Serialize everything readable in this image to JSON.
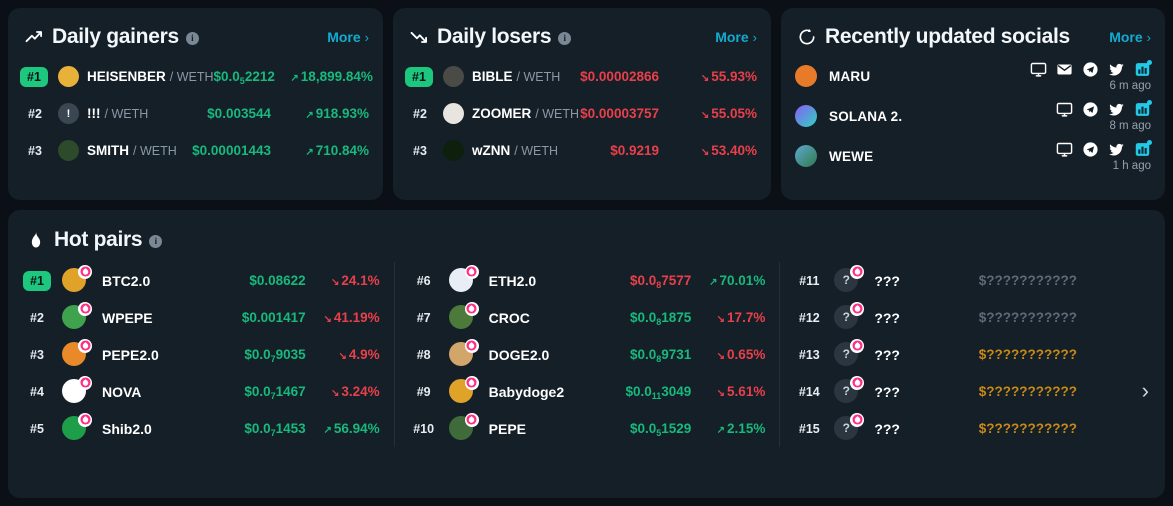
{
  "theme": {
    "page_bg": "#0a1016",
    "card_bg": "#151f28",
    "green": "#17b97c",
    "badge_green": "#1ec77e",
    "red": "#e8404a",
    "cyan": "#13abd0",
    "amber": "#c98a14",
    "muted": "#5d6b78"
  },
  "gainers": {
    "title": "Daily gainers",
    "icon": "trending-up-icon",
    "info": "i",
    "more_label": "More",
    "more_chevron": "›",
    "rows": [
      {
        "rank": "#1",
        "name": "HEISENBER",
        "quote": "/ WETH",
        "price_pre": "$0.0",
        "price_sub": "5",
        "price_post": "2212",
        "pct": "18,899.84%",
        "dir": "up",
        "arrow": "↗"
      },
      {
        "rank": "#2",
        "name": "!!!",
        "quote": "/ WETH",
        "price_pre": "$0.003544",
        "price_sub": "",
        "price_post": "",
        "pct": "918.93%",
        "dir": "up",
        "arrow": "↗"
      },
      {
        "rank": "#3",
        "name": "SMITH",
        "quote": "/ WETH",
        "price_pre": "$0.00001443",
        "price_sub": "",
        "price_post": "",
        "pct": "710.84%",
        "dir": "up",
        "arrow": "↗"
      }
    ]
  },
  "losers": {
    "title": "Daily losers",
    "icon": "trending-down-icon",
    "info": "i",
    "more_label": "More",
    "more_chevron": "›",
    "rows": [
      {
        "rank": "#1",
        "name": "BIBLE",
        "quote": "/ WETH",
        "price_pre": "$0.00002866",
        "price_sub": "",
        "price_post": "",
        "pct": "55.93%",
        "dir": "down",
        "arrow": "↘"
      },
      {
        "rank": "#2",
        "name": "ZOOMER",
        "quote": "/ WETH",
        "price_pre": "$0.00003757",
        "price_sub": "",
        "price_post": "",
        "pct": "55.05%",
        "dir": "down",
        "arrow": "↘"
      },
      {
        "rank": "#3",
        "name": "wZNN",
        "quote": "/ WETH",
        "price_pre": "$0.9219",
        "price_sub": "",
        "price_post": "",
        "pct": "53.40%",
        "dir": "down",
        "arrow": "↘"
      }
    ]
  },
  "socials": {
    "title": "Recently updated socials",
    "icon": "refresh-icon",
    "more_label": "More",
    "more_chevron": "›",
    "rows": [
      {
        "name": "MARU",
        "time": "6 m ago",
        "icons": [
          "monitor-icon",
          "email-icon",
          "telegram-icon",
          "twitter-icon",
          "chart-icon"
        ]
      },
      {
        "name": "SOLANA 2.",
        "time": "8 m ago",
        "icons": [
          "monitor-icon",
          "telegram-icon",
          "twitter-icon",
          "chart-icon"
        ]
      },
      {
        "name": "WEWE",
        "time": "1 h ago",
        "icons": [
          "monitor-icon",
          "telegram-icon",
          "twitter-icon",
          "chart-icon"
        ]
      }
    ]
  },
  "hot_pairs": {
    "title": "Hot pairs",
    "icon": "flame-icon",
    "info": "i",
    "next_chevron": "›",
    "columns": [
      [
        {
          "rank": "#1",
          "name": "BTC2.0",
          "avatar_text": "",
          "price_pre": "$0.08622",
          "price_sub": "",
          "price_post": "",
          "price_color": "green",
          "pct": "24.1%",
          "dir": "down",
          "arrow": "↘"
        },
        {
          "rank": "#2",
          "name": "WPEPE",
          "avatar_text": "",
          "price_pre": "$0.001417",
          "price_sub": "",
          "price_post": "",
          "price_color": "green",
          "pct": "41.19%",
          "dir": "down",
          "arrow": "↘"
        },
        {
          "rank": "#3",
          "name": "PEPE2.0",
          "avatar_text": "",
          "price_pre": "$0.0",
          "price_sub": "7",
          "price_post": "9035",
          "price_color": "green",
          "pct": "4.9%",
          "dir": "down",
          "arrow": "↘"
        },
        {
          "rank": "#4",
          "name": "NOVA",
          "avatar_text": "",
          "price_pre": "$0.0",
          "price_sub": "7",
          "price_post": "1467",
          "price_color": "green",
          "pct": "3.24%",
          "dir": "down",
          "arrow": "↘"
        },
        {
          "rank": "#5",
          "name": "Shib2.0",
          "avatar_text": "",
          "price_pre": "$0.0",
          "price_sub": "7",
          "price_post": "1453",
          "price_color": "green",
          "pct": "56.94%",
          "dir": "up",
          "arrow": "↗"
        }
      ],
      [
        {
          "rank": "#6",
          "name": "ETH2.0",
          "avatar_text": "",
          "price_pre": "$0.0",
          "price_sub": "8",
          "price_post": "7577",
          "price_color": "red",
          "pct": "70.01%",
          "dir": "up",
          "arrow": "↗"
        },
        {
          "rank": "#7",
          "name": "CROC",
          "avatar_text": "",
          "price_pre": "$0.0",
          "price_sub": "8",
          "price_post": "1875",
          "price_color": "green",
          "pct": "17.7%",
          "dir": "down",
          "arrow": "↘"
        },
        {
          "rank": "#8",
          "name": "DOGE2.0",
          "avatar_text": "",
          "price_pre": "$0.0",
          "price_sub": "8",
          "price_post": "9731",
          "price_color": "green",
          "pct": "0.65%",
          "dir": "down",
          "arrow": "↘"
        },
        {
          "rank": "#9",
          "name": "Babydoge2",
          "avatar_text": "",
          "price_pre": "$0.0",
          "price_sub": "11",
          "price_post": "3049",
          "price_color": "green",
          "pct": "5.61%",
          "dir": "down",
          "arrow": "↘"
        },
        {
          "rank": "#10",
          "name": "PEPE",
          "avatar_text": "",
          "price_pre": "$0.0",
          "price_sub": "5",
          "price_post": "1529",
          "price_color": "green",
          "pct": "2.15%",
          "dir": "up",
          "arrow": "↗"
        }
      ],
      [
        {
          "rank": "#11",
          "name": "???",
          "avatar_text": "?",
          "price_pre": "$???????????",
          "price_sub": "",
          "price_post": "",
          "price_color": "muted",
          "pct": "",
          "dir": "",
          "arrow": ""
        },
        {
          "rank": "#12",
          "name": "???",
          "avatar_text": "?",
          "price_pre": "$???????????",
          "price_sub": "",
          "price_post": "",
          "price_color": "muted",
          "pct": "",
          "dir": "",
          "arrow": ""
        },
        {
          "rank": "#13",
          "name": "???",
          "avatar_text": "?",
          "price_pre": "$???????????",
          "price_sub": "",
          "price_post": "",
          "price_color": "amber",
          "pct": "",
          "dir": "",
          "arrow": ""
        },
        {
          "rank": "#14",
          "name": "???",
          "avatar_text": "?",
          "price_pre": "$???????????",
          "price_sub": "",
          "price_post": "",
          "price_color": "amber",
          "pct": "",
          "dir": "",
          "arrow": ""
        },
        {
          "rank": "#15",
          "name": "???",
          "avatar_text": "?",
          "price_pre": "$???????????",
          "price_sub": "",
          "price_post": "",
          "price_color": "amber",
          "pct": "",
          "dir": "",
          "arrow": ""
        }
      ]
    ]
  }
}
